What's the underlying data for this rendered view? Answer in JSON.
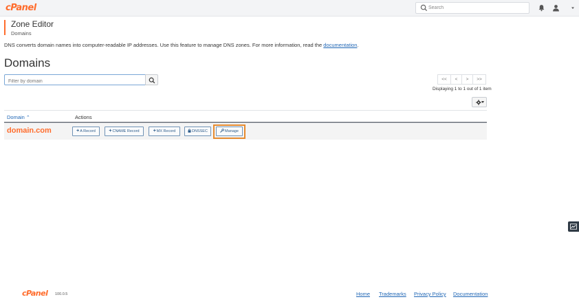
{
  "app": {
    "logo_text": "cPanel",
    "brand_color": "#ff6c2c"
  },
  "topbar": {
    "search_placeholder": "Search",
    "icons": [
      "search-icon",
      "bell-icon",
      "user-icon",
      "caret-down-icon"
    ]
  },
  "header": {
    "title": "Zone Editor",
    "breadcrumb": "Domains"
  },
  "intro": {
    "text": "DNS converts domain names into computer-readable IP addresses. Use this feature to manage DNS zones. For more information, read the ",
    "link_text": "documentation",
    "suffix": "."
  },
  "section_title": "Domains",
  "filter": {
    "placeholder": "Filter by domain"
  },
  "pagination": {
    "first": "<<",
    "prev": "<",
    "next": ">",
    "last": ">>",
    "info": "Displaying 1 to 1 out of 1 item"
  },
  "table": {
    "columns": {
      "domain": "Domain",
      "actions": "Actions"
    },
    "rows": [
      {
        "domain": "domain.com",
        "actions": {
          "a_record": "A Record",
          "cname_record": "CNAME Record",
          "mx_record": "MX Record",
          "dnssec": "DNSSEC",
          "manage": "Manage"
        }
      }
    ]
  },
  "highlight_color": "#e68a2e",
  "footer": {
    "logo_text": "cPanel",
    "version": "100.0.5",
    "links": {
      "home": "Home",
      "trademarks": "Trademarks",
      "privacy": "Privacy Policy",
      "documentation": "Documentation"
    }
  }
}
